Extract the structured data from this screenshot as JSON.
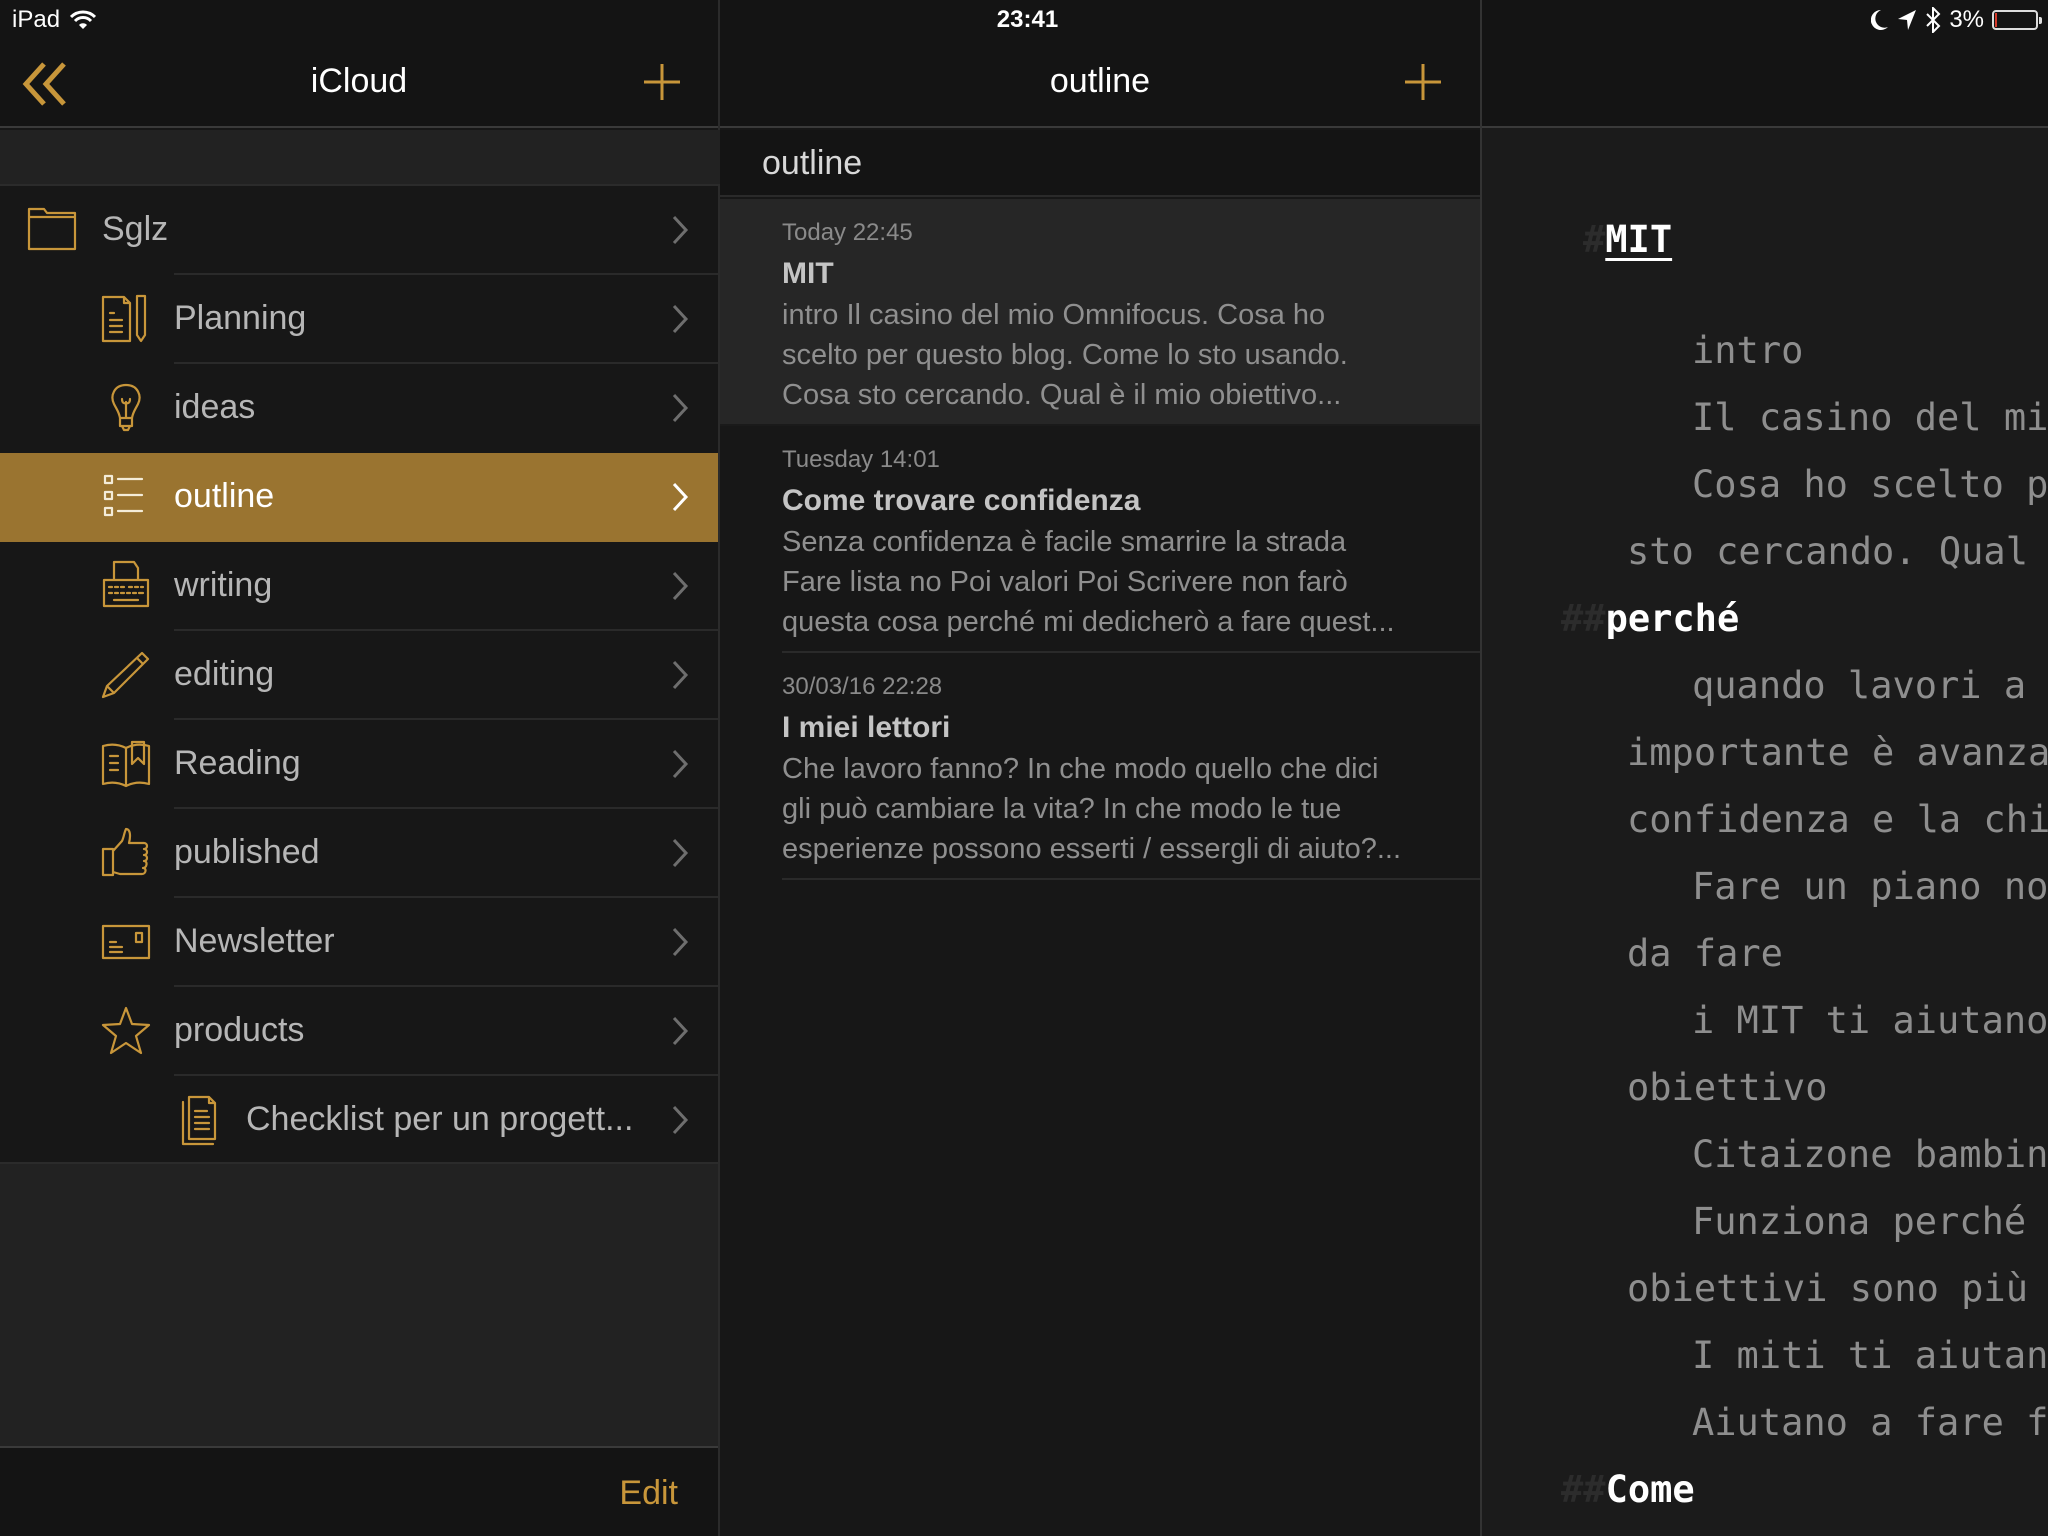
{
  "status_bar": {
    "device": "iPad",
    "time": "23:41",
    "battery_percent_label": "3%",
    "battery_level": 0.03,
    "icons": [
      "wifi-icon",
      "moon-icon",
      "location-arrow-icon",
      "bluetooth-icon",
      "battery-icon"
    ]
  },
  "colors": {
    "accent": "#c8963a",
    "selected_row": "#9a7430",
    "background": "#171717",
    "editor_background": "#1b1b1b"
  },
  "sidebar": {
    "title": "iCloud",
    "back_icon": "double-chevron-left-icon",
    "add_icon": "plus-icon",
    "edit_label": "Edit",
    "items": [
      {
        "label": "Sglz",
        "icon": "folder-icon",
        "level": 0,
        "selected": false
      },
      {
        "label": "Planning",
        "icon": "document-pencil-icon",
        "level": 1,
        "selected": false
      },
      {
        "label": "ideas",
        "icon": "lightbulb-icon",
        "level": 1,
        "selected": false
      },
      {
        "label": "outline",
        "icon": "checklist-icon",
        "level": 1,
        "selected": true
      },
      {
        "label": "writing",
        "icon": "typewriter-icon",
        "level": 1,
        "selected": false
      },
      {
        "label": "editing",
        "icon": "pencil-icon",
        "level": 1,
        "selected": false
      },
      {
        "label": "Reading",
        "icon": "open-book-icon",
        "level": 1,
        "selected": false
      },
      {
        "label": "published",
        "icon": "thumbs-up-icon",
        "level": 1,
        "selected": false
      },
      {
        "label": "Newsletter",
        "icon": "postcard-icon",
        "level": 1,
        "selected": false
      },
      {
        "label": "products",
        "icon": "star-icon",
        "level": 1,
        "selected": false
      },
      {
        "label": "Checklist per un progett...",
        "icon": "documents-icon",
        "level": 2,
        "selected": false
      }
    ]
  },
  "notes_list": {
    "title": "outline",
    "section_header": "outline",
    "add_icon": "plus-icon",
    "notes": [
      {
        "date": "Today 22:45",
        "title": "MIT",
        "preview": "intro Il casino del mio Omnifocus. Cosa ho scelto per questo blog. Come lo sto usando. Cosa sto cercando. Qual è il mio obiettivo...",
        "preview_lines": [
          "intro Il casino del mio Omnifocus. Cosa ho",
          "scelto per questo blog. Come lo sto usando.",
          "Cosa sto cercando. Qual è il mio obiettivo..."
        ],
        "active": true
      },
      {
        "date": "Tuesday 14:01",
        "title": "Come trovare confidenza",
        "preview_lines": [
          "Senza confidenza è facile smarrire la strada",
          "Fare lista no Poi valori Poi Scrivere non farò",
          "questa cosa perché mi dedicherò a fare quest..."
        ],
        "active": false
      },
      {
        "date": "30/03/16 22:28",
        "title": "I miei lettori",
        "preview_lines": [
          "Che lavoro fanno? In che modo quello che dici",
          "gli può cambiare la vita? In che modo le tue",
          "esperienze possono esserti / essergli di aiuto?..."
        ],
        "active": false
      }
    ]
  },
  "editor": {
    "lines": [
      {
        "type": "h1",
        "hash": "#",
        "text": "MIT"
      },
      {
        "type": "blank",
        "text": ""
      },
      {
        "type": "indent",
        "text": "intro"
      },
      {
        "type": "indent",
        "text": "Il casino del mio Omnifocus."
      },
      {
        "type": "indent",
        "text": "Cosa ho scelto per questo blog. Come lo"
      },
      {
        "type": "wrap",
        "text": "sto cercando. Qual è il mio obiettivo"
      },
      {
        "type": "h2",
        "hash": "##",
        "text": "perché"
      },
      {
        "type": "indent",
        "text": "quando lavori a un progetto"
      },
      {
        "type": "wrap",
        "text": "importante è avanzare"
      },
      {
        "type": "wrap",
        "text": "confidenza e la chiarezza"
      },
      {
        "type": "indent",
        "text": "Fare un piano non"
      },
      {
        "type": "wrap",
        "text": "da fare"
      },
      {
        "type": "indent",
        "text": "i MIT ti aiutano a"
      },
      {
        "type": "wrap",
        "text": "obiettivo"
      },
      {
        "type": "indent",
        "text": "Citaizone bambini"
      },
      {
        "type": "indent",
        "text": "Funziona perché o"
      },
      {
        "type": "wrap",
        "text": "obiettivi sono più f"
      },
      {
        "type": "indent",
        "text": "I miti ti aiutano"
      },
      {
        "type": "indent",
        "text": "Aiutano a fare fo"
      },
      {
        "type": "h2",
        "hash": "##",
        "text": "Come"
      }
    ]
  }
}
